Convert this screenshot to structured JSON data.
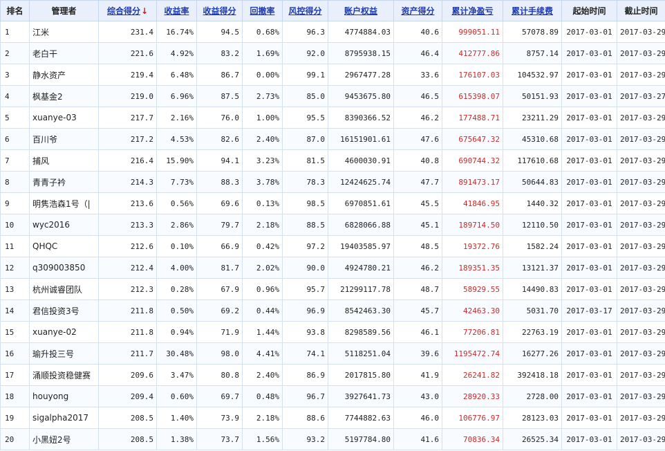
{
  "table": {
    "headers": [
      "排名",
      "管理者",
      "综合得分",
      "收益率",
      "收益得分",
      "回撤率",
      "风控得分",
      "账户权益",
      "资产得分",
      "累计净盈亏",
      "累计手续费",
      "起始时间",
      "截止时间"
    ],
    "sort_indicator": "↓",
    "rows": [
      [
        "1",
        "江米",
        "231.4",
        "16.74%",
        "94.5",
        "0.68%",
        "96.3",
        "4774884.03",
        "40.6",
        "999051.11",
        "57078.89",
        "2017-03-01",
        "2017-03-29"
      ],
      [
        "2",
        "老白干",
        "221.6",
        "4.92%",
        "83.2",
        "1.69%",
        "92.0",
        "8795938.15",
        "46.4",
        "412777.86",
        "8757.14",
        "2017-03-01",
        "2017-03-29"
      ],
      [
        "3",
        "静水资产",
        "219.4",
        "6.48%",
        "86.7",
        "0.00%",
        "99.1",
        "2967477.28",
        "33.6",
        "176107.03",
        "104532.97",
        "2017-03-01",
        "2017-03-29"
      ],
      [
        "4",
        "枫基金2",
        "219.0",
        "6.96%",
        "87.5",
        "2.73%",
        "85.0",
        "9453675.80",
        "46.5",
        "615398.07",
        "50151.93",
        "2017-03-01",
        "2017-03-27"
      ],
      [
        "5",
        "xuanye-03",
        "217.7",
        "2.16%",
        "76.0",
        "1.00%",
        "95.5",
        "8390366.52",
        "46.2",
        "177488.71",
        "23211.29",
        "2017-03-01",
        "2017-03-29"
      ],
      [
        "6",
        "百川爷",
        "217.2",
        "4.53%",
        "82.6",
        "2.40%",
        "87.0",
        "16151901.61",
        "47.6",
        "675647.32",
        "45310.68",
        "2017-03-01",
        "2017-03-29"
      ],
      [
        "7",
        "捕风",
        "216.4",
        "15.90%",
        "94.1",
        "3.23%",
        "81.5",
        "4600030.91",
        "40.8",
        "690744.32",
        "117610.68",
        "2017-03-01",
        "2017-03-29"
      ],
      [
        "8",
        "青青子衿",
        "214.3",
        "7.73%",
        "88.3",
        "3.78%",
        "78.3",
        "12424625.74",
        "47.7",
        "891473.17",
        "50644.83",
        "2017-03-01",
        "2017-03-29"
      ],
      [
        "9",
        "明隽浩森1号（|",
        "213.6",
        "0.56%",
        "69.6",
        "0.13%",
        "98.5",
        "6970851.61",
        "45.5",
        "41846.95",
        "1440.32",
        "2017-03-01",
        "2017-03-29"
      ],
      [
        "10",
        "wyc2016",
        "213.3",
        "2.86%",
        "79.7",
        "2.18%",
        "88.5",
        "6828066.88",
        "45.1",
        "189714.50",
        "12110.50",
        "2017-03-01",
        "2017-03-29"
      ],
      [
        "11",
        "QHQC",
        "212.6",
        "0.10%",
        "66.9",
        "0.42%",
        "97.2",
        "19403585.97",
        "48.5",
        "19372.76",
        "1582.24",
        "2017-03-01",
        "2017-03-29"
      ],
      [
        "12",
        "q309003850",
        "212.4",
        "4.00%",
        "81.7",
        "2.02%",
        "90.0",
        "4924780.21",
        "46.2",
        "189351.35",
        "13121.37",
        "2017-03-01",
        "2017-03-29"
      ],
      [
        "13",
        "杭州诚睿团队",
        "212.3",
        "0.28%",
        "67.9",
        "0.96%",
        "95.7",
        "21299117.78",
        "48.7",
        "58929.55",
        "14490.83",
        "2017-03-01",
        "2017-03-29"
      ],
      [
        "14",
        "君信投资3号",
        "211.8",
        "0.50%",
        "69.2",
        "0.44%",
        "96.9",
        "8542463.30",
        "45.7",
        "42463.30",
        "5031.70",
        "2017-03-17",
        "2017-03-29"
      ],
      [
        "15",
        "xuanye-02",
        "211.8",
        "0.94%",
        "71.9",
        "1.44%",
        "93.8",
        "8298589.56",
        "46.1",
        "77206.81",
        "22763.19",
        "2017-03-01",
        "2017-03-29"
      ],
      [
        "16",
        "瑜升投三号",
        "211.7",
        "30.48%",
        "98.0",
        "4.41%",
        "74.1",
        "5118251.04",
        "39.6",
        "1195472.74",
        "16277.26",
        "2017-03-01",
        "2017-03-29"
      ],
      [
        "17",
        "涌顺投资稳健赛",
        "209.6",
        "3.47%",
        "80.8",
        "2.40%",
        "86.9",
        "2017815.80",
        "41.9",
        "26241.82",
        "392418.18",
        "2017-03-01",
        "2017-03-29"
      ],
      [
        "18",
        "houyong",
        "209.4",
        "0.60%",
        "69.7",
        "0.48%",
        "96.7",
        "3927641.73",
        "43.0",
        "28920.33",
        "2728.00",
        "2017-03-01",
        "2017-03-29"
      ],
      [
        "19",
        "sigalpha2017",
        "208.5",
        "1.40%",
        "73.9",
        "2.18%",
        "88.6",
        "7744882.63",
        "46.0",
        "106776.97",
        "28123.03",
        "2017-03-01",
        "2017-03-29"
      ],
      [
        "20",
        "小黑妞2号",
        "208.5",
        "1.38%",
        "73.7",
        "1.56%",
        "93.2",
        "5197784.80",
        "41.6",
        "70836.34",
        "26525.34",
        "2017-03-01",
        "2017-03-29"
      ]
    ]
  }
}
